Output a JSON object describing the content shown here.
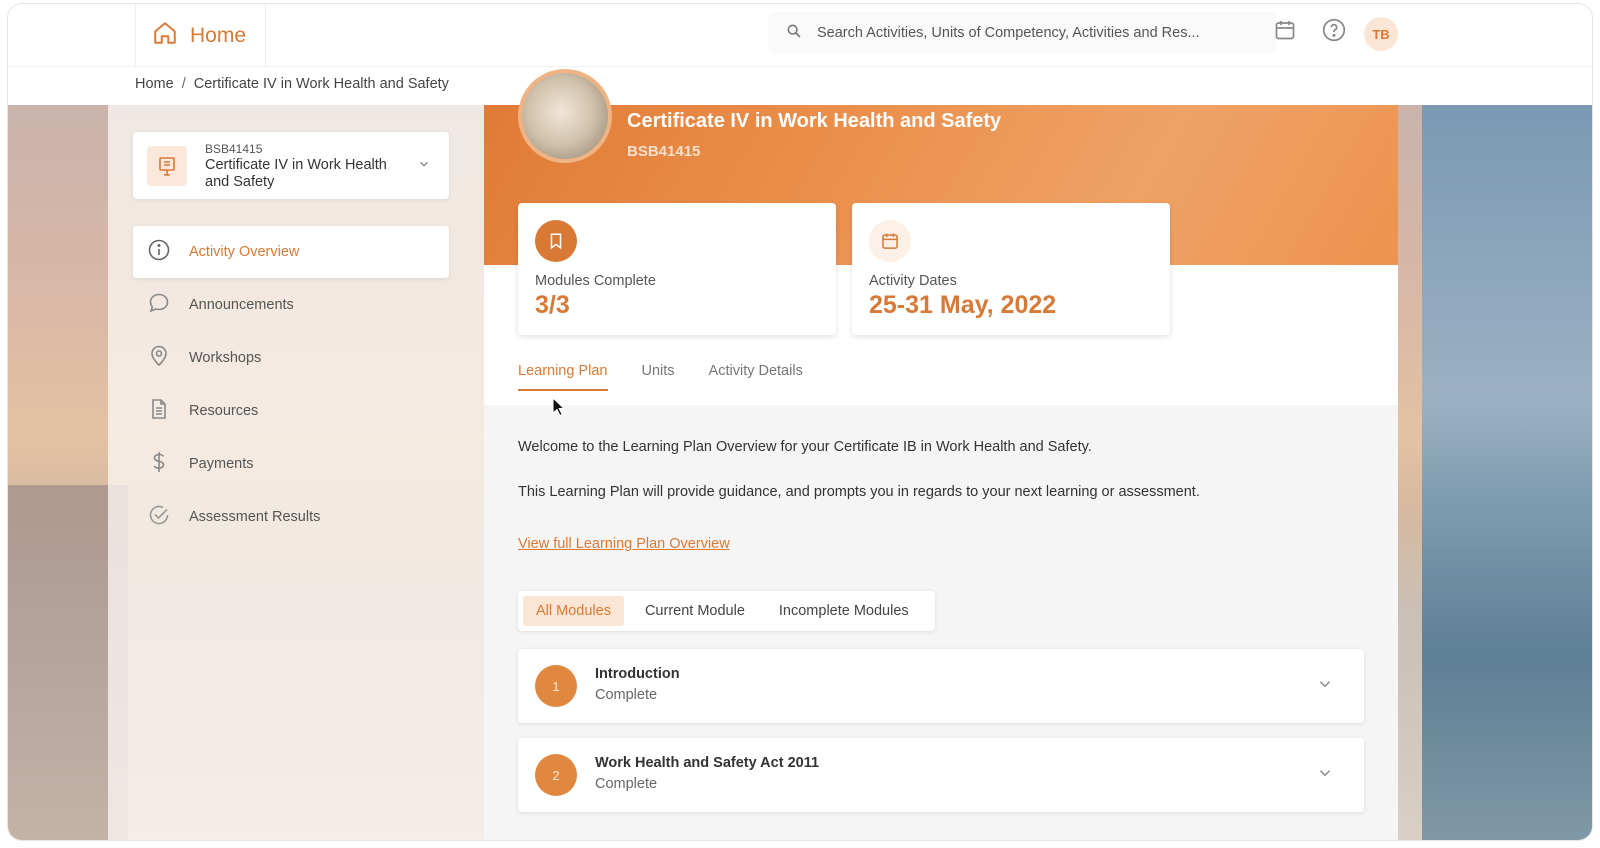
{
  "header": {
    "home_label": "Home",
    "search_placeholder": "Search Activities, Units of Competency, Activities and Res...",
    "avatar_initials": "TB"
  },
  "breadcrumb": {
    "items": [
      "Home",
      "Certificate IV in Work Health and Safety"
    ],
    "separator": "/"
  },
  "course_selector": {
    "code": "BSB41415",
    "name": "Certificate IV in Work Health and Safety"
  },
  "sidebar": {
    "items": [
      {
        "label": "Activity Overview",
        "icon": "info-icon",
        "active": true
      },
      {
        "label": "Announcements",
        "icon": "chat-bubble-icon"
      },
      {
        "label": "Workshops",
        "icon": "location-pin-icon"
      },
      {
        "label": "Resources",
        "icon": "document-icon"
      },
      {
        "label": "Payments",
        "icon": "dollar-icon"
      },
      {
        "label": "Assessment Results",
        "icon": "check-circle-icon"
      }
    ]
  },
  "hero": {
    "title": "Certificate IV in Work Health and Safety",
    "code": "BSB41415"
  },
  "stats": {
    "modules": {
      "label": "Modules Complete",
      "value": "3/3",
      "icon": "bookmark-icon"
    },
    "dates": {
      "label": "Activity Dates",
      "value": "25-31 May, 2022",
      "icon": "calendar-icon"
    }
  },
  "tabs": [
    "Learning Plan",
    "Units",
    "Activity Details"
  ],
  "content": {
    "welcome": "Welcome to the Learning Plan Overview for your Certificate IB in Work Health and Safety.",
    "guidance": "This Learning Plan will provide guidance, and prompts you in regards to your next learning or assessment.",
    "link": "View full Learning Plan Overview"
  },
  "filters": [
    "All Modules",
    "Current Module",
    "Incomplete Modules"
  ],
  "modules": [
    {
      "number": "1",
      "title": "Introduction",
      "status": "Complete"
    },
    {
      "number": "2",
      "title": "Work Health and Safety Act 2011",
      "status": "Complete"
    }
  ],
  "colors": {
    "accent": "#d87a35",
    "accent_light": "#fbe6d6",
    "hero_orange": "#e07b36"
  }
}
